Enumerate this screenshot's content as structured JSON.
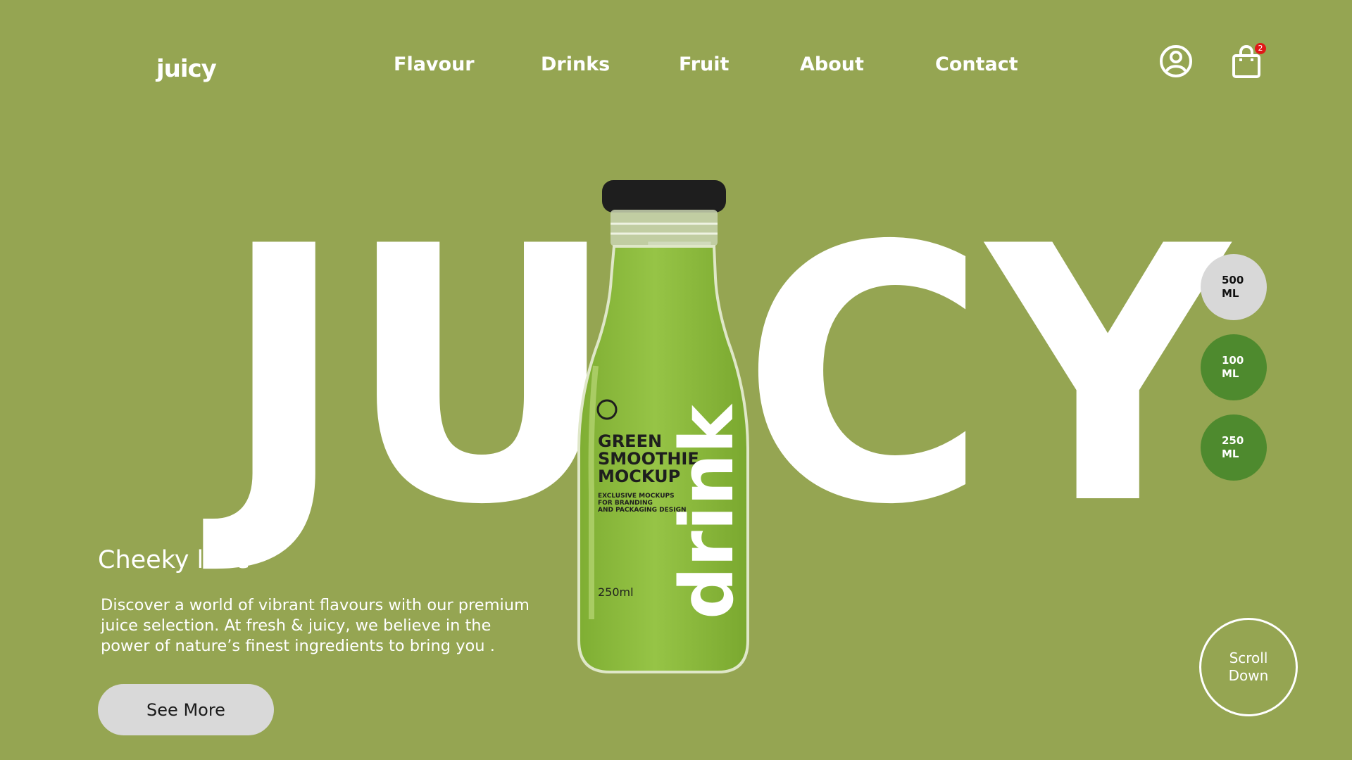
{
  "brand": {
    "logo_text": "juicy"
  },
  "nav": {
    "items": [
      {
        "label": "Flavour"
      },
      {
        "label": "Drinks"
      },
      {
        "label": "Fruit"
      },
      {
        "label": "About"
      },
      {
        "label": "Contact"
      }
    ]
  },
  "header_icons": {
    "account_icon": "user-circle-icon",
    "cart_icon": "shopping-bag-icon",
    "cart_count": "2"
  },
  "hero": {
    "word": "JUICY"
  },
  "bottle": {
    "title_line1": "GREEN",
    "title_line2": "SMOOTHIE",
    "title_line3": "MOCKUP",
    "sub_line1": "EXCLUSIVE MOCKUPS",
    "sub_line2": "FOR BRANDING",
    "sub_line3": "AND PACKAGING DESIGN",
    "volume": "250ml",
    "side_word": "drink"
  },
  "sizes": [
    {
      "line1": "500",
      "line2": "ML",
      "selected": true
    },
    {
      "line1": "100",
      "line2": "ML",
      "selected": false
    },
    {
      "line1": "250",
      "line2": "ML",
      "selected": false
    }
  ],
  "product": {
    "title": "Cheeky lime",
    "description_line1": "Discover a world of vibrant flavours with our premium",
    "description_line2": "juice selection. At fresh & juicy, we believe in the",
    "description_line3": "power of nature’s finest ingredients to bring you ."
  },
  "cta": {
    "see_more_label": "See More"
  },
  "scroll": {
    "line1": "Scroll",
    "line2": "Down"
  },
  "colors": {
    "background": "#95a552",
    "accent_green": "#4e8a2e",
    "light_button": "#d9d9d9",
    "badge_red": "#e01818",
    "juice_green": "#8dba3e"
  }
}
